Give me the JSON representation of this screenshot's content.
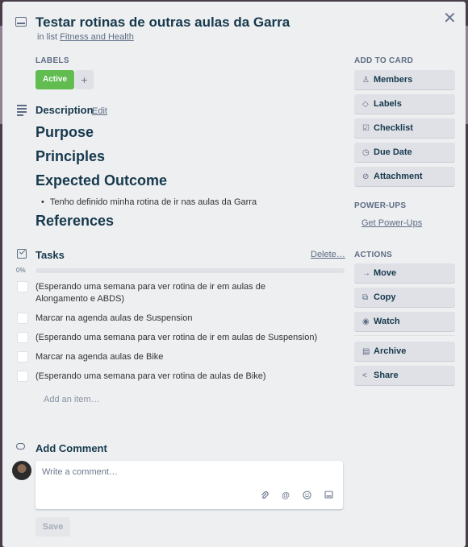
{
  "card": {
    "title": "Testar rotinas de outras aulas da Garra",
    "in_list_prefix": "in list",
    "list_name": "Fitness and Health",
    "close_symbol": "✕"
  },
  "labels": {
    "heading": "LABELS",
    "items": [
      {
        "text": "Active",
        "color": "#61bd4f"
      }
    ],
    "add_symbol": "+"
  },
  "description": {
    "heading": "Description",
    "edit_link": "Edit",
    "purpose": "Purpose",
    "principles": "Principles",
    "expected_outcome": "Expected Outcome",
    "bullets": [
      "Tenho definido minha rotina de ir nas aulas da Garra"
    ],
    "references": "References"
  },
  "tasks": {
    "heading": "Tasks",
    "delete_link": "Delete…",
    "percent": "0%",
    "progress_fraction": 0,
    "items": [
      "(Esperando uma semana para ver rotina de ir em aulas de Alongamento e ABDS)",
      "Marcar na agenda aulas de Suspension",
      "(Esperando uma semana para ver rotina de ir em aulas de Suspension)",
      "Marcar na agenda aulas de Bike",
      "(Esperando uma semana para ver rotina de aulas de Bike)"
    ],
    "add_item": "Add an item…"
  },
  "comment": {
    "heading": "Add Comment",
    "placeholder": "Write a comment…",
    "save_label": "Save",
    "icons": [
      "paperclip-icon",
      "at-mention-icon",
      "emoji-icon",
      "card-link-icon"
    ]
  },
  "sidebar": {
    "add_to_card_heading": "ADD TO CARD",
    "add_to_card": [
      {
        "label": "Members",
        "icon": "member-icon"
      },
      {
        "label": "Labels",
        "icon": "label-icon"
      },
      {
        "label": "Checklist",
        "icon": "checklist-icon"
      },
      {
        "label": "Due Date",
        "icon": "clock-icon"
      },
      {
        "label": "Attachment",
        "icon": "paperclip-icon"
      }
    ],
    "power_ups_heading": "POWER-UPS",
    "get_power_ups": "Get Power-Ups",
    "actions_heading": "ACTIONS",
    "actions": [
      {
        "label": "Move",
        "icon": "arrow-right-icon"
      },
      {
        "label": "Copy",
        "icon": "copy-icon"
      },
      {
        "label": "Watch",
        "icon": "eye-icon"
      },
      {
        "label": "Archive",
        "icon": "archive-icon"
      },
      {
        "label": "Share",
        "icon": "share-icon"
      }
    ]
  }
}
